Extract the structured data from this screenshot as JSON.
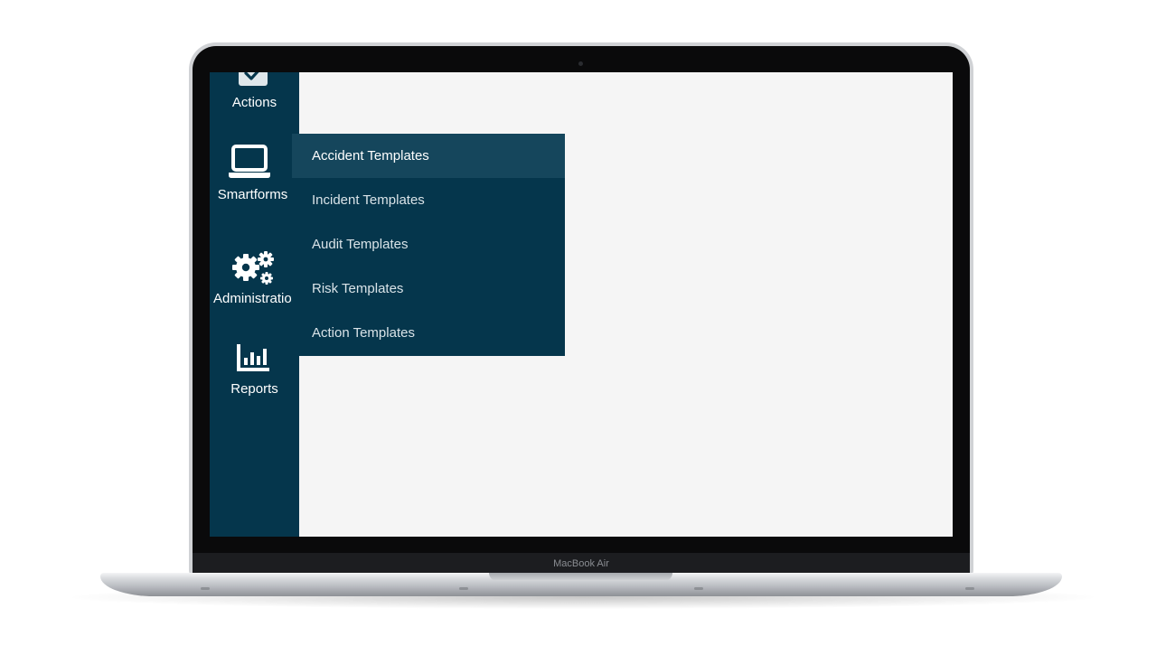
{
  "device": {
    "brand_label": "MacBook Air"
  },
  "sidebar": {
    "items": [
      {
        "label": "Actions",
        "icon": "check-square-icon"
      },
      {
        "label": "Smartforms",
        "icon": "laptop-icon"
      },
      {
        "label": "Administratio",
        "icon": "gears-icon"
      },
      {
        "label": "Reports",
        "icon": "bar-chart-icon"
      }
    ]
  },
  "submenu": {
    "items": [
      {
        "label": "Accident Templates",
        "active": true
      },
      {
        "label": "Incident Templates"
      },
      {
        "label": "Audit Templates"
      },
      {
        "label": "Risk Templates"
      },
      {
        "label": "Action Templates"
      }
    ]
  },
  "colors": {
    "sidebar_bg": "#05364c",
    "submenu_active_bg": "#15465c",
    "content_bg": "#f5f5f5"
  }
}
